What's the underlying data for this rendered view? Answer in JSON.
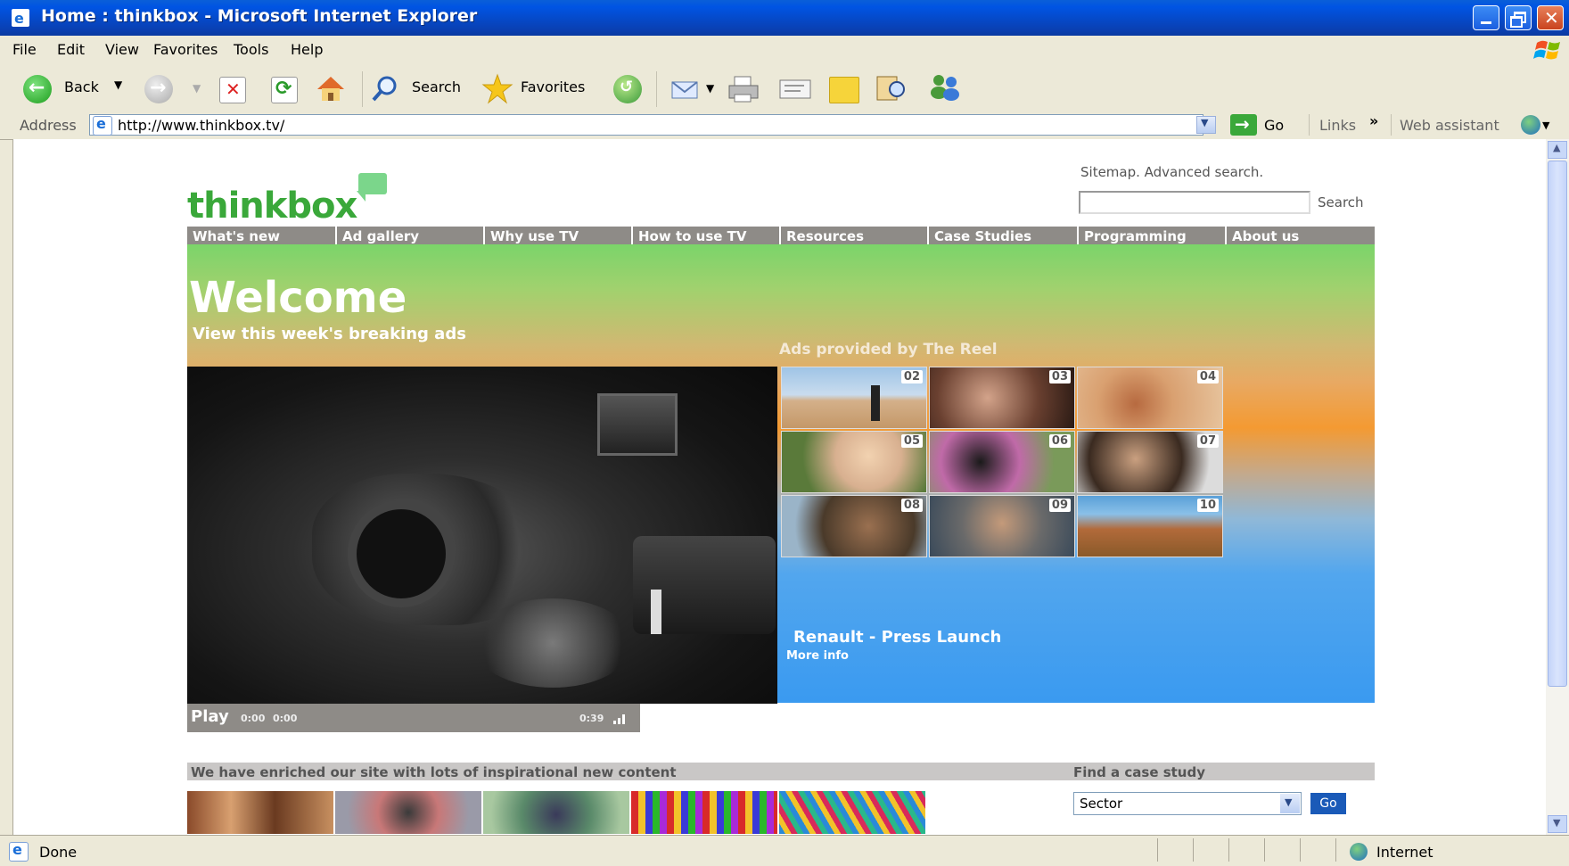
{
  "window": {
    "title": "Home : thinkbox - Microsoft Internet Explorer"
  },
  "menu": {
    "items": [
      "File",
      "Edit",
      "View",
      "Favorites",
      "Tools",
      "Help"
    ]
  },
  "toolbar": {
    "back_label": "Back",
    "search_label": "Search",
    "favorites_label": "Favorites"
  },
  "address": {
    "label": "Address",
    "url": "http://www.thinkbox.tv/",
    "go_label": "Go",
    "links_label": "Links",
    "web_assistant_label": "Web assistant"
  },
  "page": {
    "logo": "thinkbox",
    "top_links": "Sitemap. Advanced search.",
    "search_button": "Search",
    "nav": [
      "What's new",
      "Ad gallery",
      "Why use TV",
      "How to use TV",
      "Resources",
      "Case Studies",
      "Programming",
      "About us"
    ],
    "welcome_title": "Welcome",
    "welcome_subtitle": "View this week's breaking ads",
    "ads_provided_label": "Ads provided by The Reel",
    "thumbnails": [
      "02",
      "03",
      "04",
      "05",
      "06",
      "07",
      "08",
      "09",
      "10"
    ],
    "featured_title": "Renault - Press Launch",
    "more_info": "More info",
    "player": {
      "play_label": "Play",
      "time_elapsed": "0:00",
      "time_buffered": "0:00",
      "duration": "0:39"
    },
    "enriched_heading": "We have enriched our site with lots of inspirational new content",
    "find_case_study_heading": "Find a case study",
    "sector_select": "Sector",
    "sector_go": "Go"
  },
  "status": {
    "text": "Done",
    "zone": "Internet"
  },
  "colors": {
    "xp_blue": "#0054e3",
    "nav_gray": "#8e8b87",
    "hero_green": "#7bd46a",
    "hero_orange": "#f49a32",
    "hero_blue": "#3a9af0",
    "logo_green": "#3aa83a"
  }
}
